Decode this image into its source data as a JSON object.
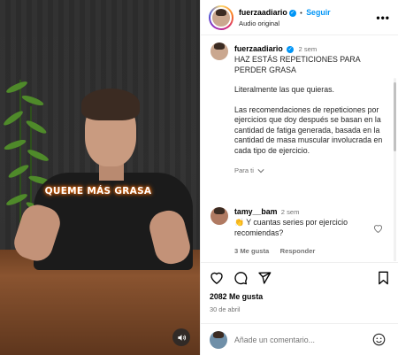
{
  "post": {
    "username": "fuerzaadiario",
    "follow_label": "Seguir",
    "separator": "•",
    "audio": "Audio original",
    "more_glyph": "•••"
  },
  "video": {
    "caption": "QUEME MÁS GRASA"
  },
  "description": {
    "username": "fuerzaadiario",
    "time": "2 sem",
    "title": "HAZ ESTÁS REPETICIONES PARA PERDER GRASA",
    "paragraph1": "Literalmente las que quieras.",
    "paragraph2": "Las recomendaciones de repeticiones por ejercicios que doy después se basan en la cantidad de fatiga generada, basada en la cantidad de masa muscular involucrada en cada tipo de ejercicio.",
    "translation_link": "Para ti"
  },
  "comments": [
    {
      "username": "tamy__bam",
      "time": "2 sem",
      "text": "👏 Y cuantas series por ejercicio recomiendas?",
      "likes": "3 Me gusta",
      "reply_label": "Responder"
    }
  ],
  "stats": {
    "likes": "2082 Me gusta",
    "date": "30 de abril"
  },
  "composer": {
    "placeholder": "Añade un comentario..."
  }
}
